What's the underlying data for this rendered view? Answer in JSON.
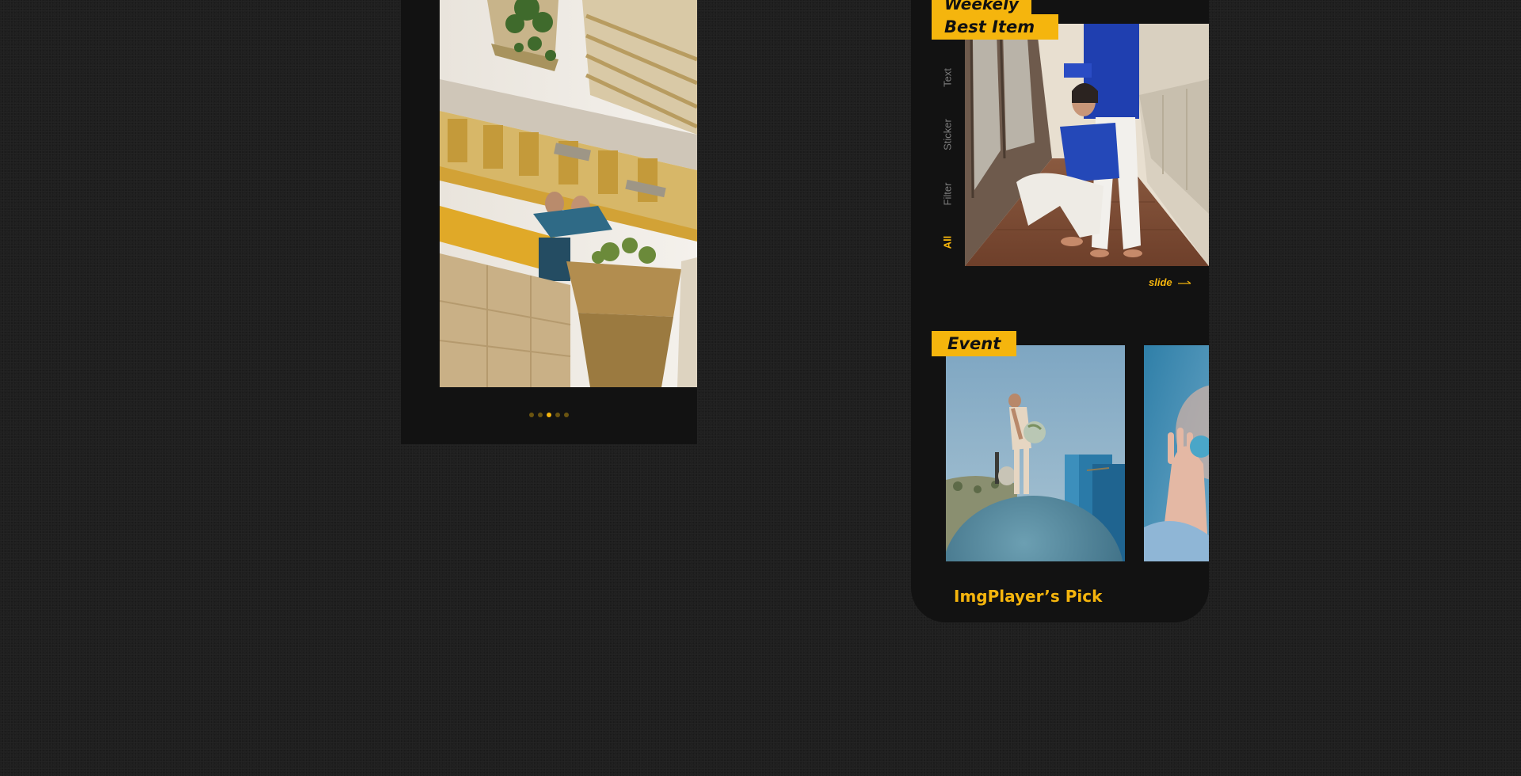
{
  "brand": {
    "accent": "#f5b50d",
    "background": "#1f1f1f",
    "panel": "#121212",
    "inactive_text": "#7c7c7c"
  },
  "left_screen": {
    "photo": "photo of two people leaning over a balcony railing of a beige building with plants",
    "pager": {
      "count": 5,
      "active_index": 2
    }
  },
  "right_screen": {
    "weekly_best": {
      "title_line1": "Weekely",
      "title_line2": "Best Item",
      "filters": [
        {
          "label": "Text",
          "active": false
        },
        {
          "label": "Sticker",
          "active": false
        },
        {
          "label": "Filter",
          "active": false
        },
        {
          "label": "All",
          "active": true
        }
      ],
      "photo": "photo of two people in blue shirts and white pants in a sunny corridor",
      "slide_label": "slide",
      "slide_icon": "arrow-right-icon"
    },
    "event": {
      "title": "Event",
      "cards": [
        {
          "photo": "woman standing on a large blue sphere holding a globe"
        },
        {
          "photo": "close-up of a hand holding a blue glass ball"
        }
      ]
    },
    "pick": {
      "title": "ImgPlayer’s Pick"
    }
  }
}
